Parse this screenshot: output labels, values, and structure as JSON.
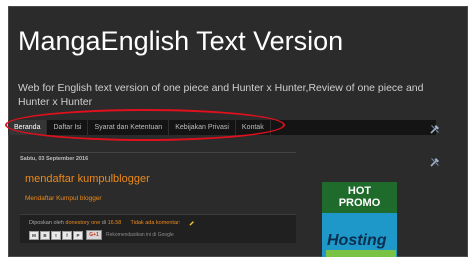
{
  "header": {
    "title": "MangaEnglish Text Version",
    "description": "Web for English text version of one piece and Hunter x Hunter,Review of one piece and Hunter x Hunter"
  },
  "nav": {
    "tabs": [
      {
        "label": "Beranda",
        "active": true
      },
      {
        "label": "Daftar Isi",
        "active": false
      },
      {
        "label": "Syarat dan Ketentuan",
        "active": false
      },
      {
        "label": "Kebijakan Privasi",
        "active": false
      },
      {
        "label": "Kontak",
        "active": false
      }
    ]
  },
  "post": {
    "date": "Sabtu, 03 September 2016",
    "title": "mendaftar kumpulblogger",
    "link_text": "Mendaftar Kumpul blogger",
    "posted_by_label": "Diposkan oleh",
    "author": "donestory one",
    "at_label": "di",
    "time": "16.58",
    "comments": "Tidak ada komentar:",
    "share_buttons": [
      "M",
      "B",
      "t",
      "f",
      "P"
    ],
    "gplus_label": "G+1",
    "recommend_text": "Rekomendasikan ini di Google"
  },
  "sidebar": {
    "ad": {
      "line1": "HOT",
      "line2": "PROMO",
      "hosting": "Hosting"
    }
  },
  "colors": {
    "background": "#2b2b2b",
    "accent": "#ee8a1b",
    "highlight_ellipse": "#e0101c"
  },
  "icons": [
    "tools-icon",
    "pencil-icon"
  ]
}
